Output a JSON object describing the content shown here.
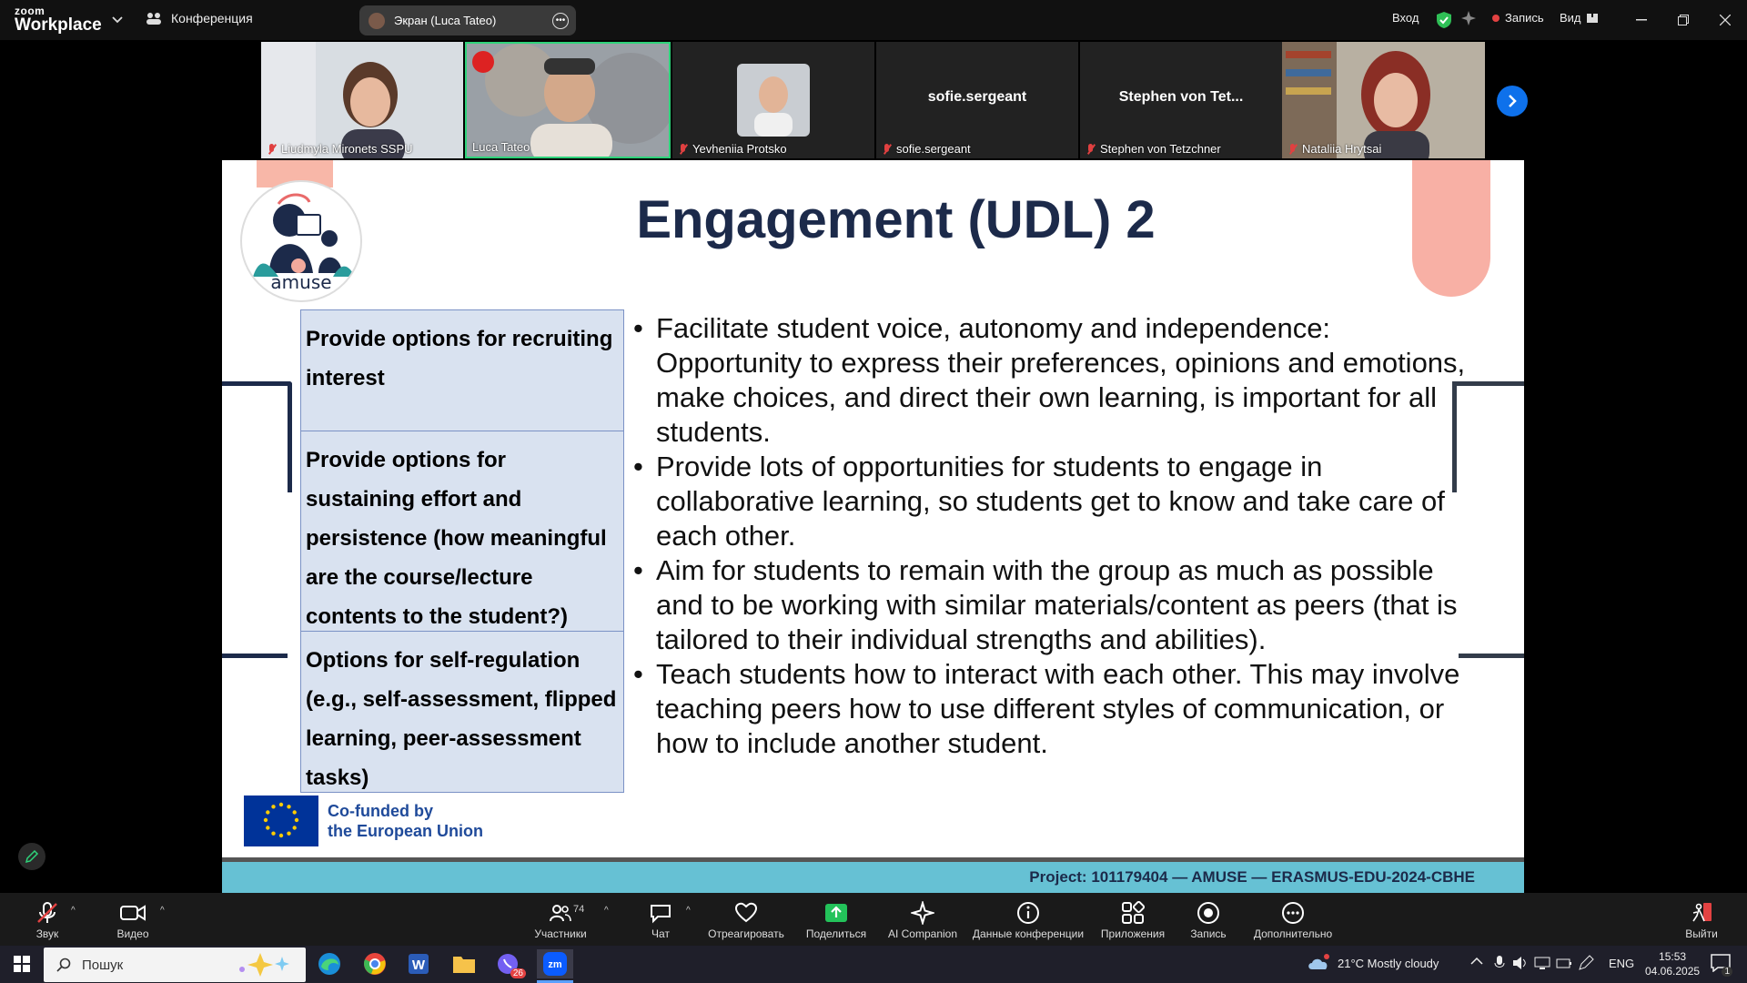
{
  "app": {
    "logo_top": "zoom",
    "logo_bottom": "Workplace",
    "meeting_label": "Конференция",
    "screen_share_label": "Экран (Luca Tateo)",
    "signin": "Вход",
    "recording": "Запись",
    "view": "Вид"
  },
  "participants": [
    {
      "name": "Liudmyla Mironets SSPU",
      "video": true
    },
    {
      "name": "Luca Tateo",
      "video": true,
      "active": true
    },
    {
      "name": "Yevheniia Protsko",
      "video": true
    },
    {
      "name": "sofie.sergeant",
      "display": "sofie.sergeant",
      "video": false
    },
    {
      "name": "Stephen von Tetzchner",
      "display": "Stephen von Tet...",
      "video": false
    },
    {
      "name": "Nataliia Hrytsai",
      "video": true
    }
  ],
  "slide": {
    "title": "Engagement (UDL) 2",
    "logo_text": "amuse",
    "table": [
      "Provide options for recruiting interest",
      "Provide options for sustaining effort and persistence (how meaningful are the course/lecture contents to the student?)",
      "Options for self-regulation (e.g., self-assessment, flipped learning, peer-assessment tasks)"
    ],
    "bullets": [
      "Facilitate student voice, autonomy and independence: Opportunity to express their preferences, opinions and emotions, make choices, and direct their own learning, is important for all students.",
      "Provide lots of opportunities for students to engage in collaborative learning, so students get to know and take care of each other.",
      "Aim for students to remain with the group as much as possible and to be working with similar materials/content as peers (that is tailored to their individual strengths and abilities).",
      "Teach students how to interact with each other. This may involve teaching peers how to use different styles of communication, or how to include another student."
    ],
    "eu_line1": "Co-funded by",
    "eu_line2": "the European Union",
    "footer": "Project: 101179404 — AMUSE — ERASMUS-EDU-2024-CBHE"
  },
  "toolbar": {
    "audio": "Звук",
    "video": "Видео",
    "participants": "Участники",
    "participants_count": "74",
    "chat": "Чат",
    "react": "Отреагировать",
    "share": "Поделиться",
    "ai": "AI Companion",
    "info": "Данные конференции",
    "apps": "Приложения",
    "record": "Запись",
    "more": "Дополнительно",
    "leave": "Выйти"
  },
  "taskbar": {
    "search": "Пошук",
    "outlook_badge": "26",
    "weather": "21°C  Mostly cloudy",
    "lang": "ENG",
    "time": "15:53",
    "date": "04.06.2025",
    "notif": "1"
  },
  "colors": {
    "accent_blue": "#0e71eb",
    "active_border": "#2ed37a",
    "slide_title": "#1c2a4a",
    "table_fill": "#d9e2f0",
    "footer_band": "#66c1d4",
    "share_green": "#23c25a"
  }
}
